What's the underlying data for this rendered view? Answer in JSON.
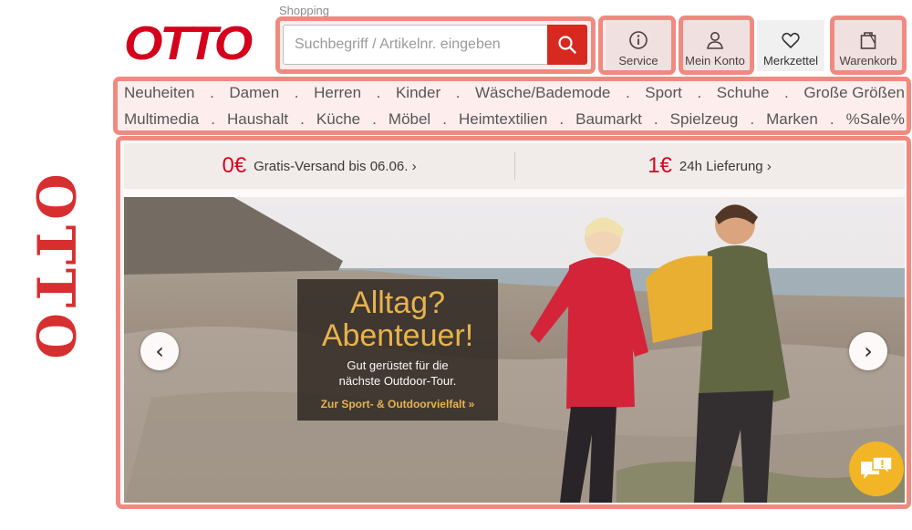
{
  "annotation": {
    "side_word": "OTTO"
  },
  "header": {
    "logo_text": "OTTO",
    "section_label": "Shopping",
    "search": {
      "placeholder": "Suchbegriff / Artikelnr. eingeben"
    },
    "buttons": [
      {
        "label": "Service",
        "icon": "info-icon"
      },
      {
        "label": "Mein Konto",
        "icon": "user-icon"
      },
      {
        "label": "Merkzettel",
        "icon": "heart-icon"
      },
      {
        "label": "Warenkorb",
        "icon": "bag-icon"
      }
    ]
  },
  "nav": {
    "row1": [
      "Neuheiten",
      "Damen",
      "Herren",
      "Kinder",
      "Wäsche/Bademode",
      "Sport",
      "Schuhe",
      "Große Größen"
    ],
    "row2": [
      "Multimedia",
      "Haushalt",
      "Küche",
      "Möbel",
      "Heimtextilien",
      "Baumarkt",
      "Spielzeug",
      "Marken",
      "%Sale%"
    ],
    "separator": "."
  },
  "promo": {
    "left": {
      "big": "0€",
      "text": "Gratis-Versand bis 06.06. ›"
    },
    "right": {
      "big": "1€",
      "text": "24h Lieferung ›"
    }
  },
  "hero": {
    "headline_1": "Alltag?",
    "headline_2": "Abenteuer!",
    "subline_1": "Gut gerüstet für die",
    "subline_2": "nächste Outdoor-Tour.",
    "cta": "Zur Sport- & Outdoorvielfalt »",
    "prev": "‹",
    "next": "›"
  },
  "colors": {
    "brand_red": "#d4001c",
    "highlight": "#f08a80",
    "overlay_text": "#e8b64a",
    "chat": "#f2b526"
  }
}
